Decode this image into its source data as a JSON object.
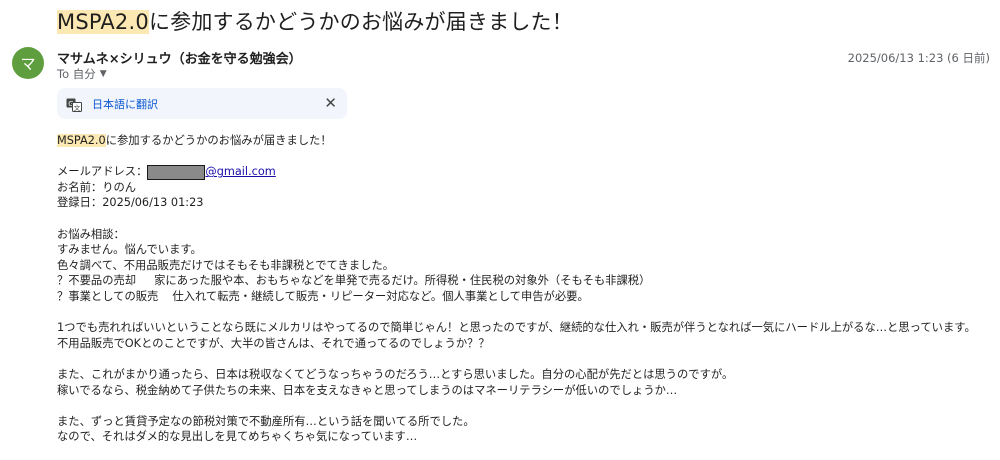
{
  "subject": {
    "highlight": "MSPA2.0",
    "rest": "に参加するかどうかのお悩みが届きました！"
  },
  "avatar": {
    "letter": "マ",
    "color": "#5f9e3e"
  },
  "sender": {
    "name": "マサムネ×シリュウ（お金を守る勉強会）"
  },
  "date": "2025/06/13 1:23 (6 日前)",
  "to_line": "To 自分",
  "translate_bar": {
    "label": "日本語に翻訳",
    "icon": "translate-icon",
    "close": "✕"
  },
  "body": {
    "intro_highlight": "MSPA2.0",
    "intro_rest": "に参加するかどうかのお悩みが届きました！",
    "email_label": "メールアドレス：",
    "email_domain": "@gmail.com",
    "name_line": "お名前：りのん",
    "registered_line": "登録日：2025/06/13 01:23",
    "consult_label": "お悩み相談：",
    "p1": [
      "すみません。悩んでいます。",
      "色々調べて、不用品販売だけではそもそも非課税とでてきました。"
    ],
    "item1_a": "？不要品の売却",
    "item1_b": "家にあった服や本、おもちゃなどを単発で売るだけ。所得税・住民税の対象外（そもそも非課税）",
    "item2_a": "？事業としての販売",
    "item2_b": "仕入れて転売・継続して販売・リピーター対応など。個人事業として申告が必要。",
    "p2": [
      "1つでも売れればいいということなら既にメルカリはやってるので簡単じゃん！と思ったのですが、継続的な仕入れ・販売が伴うとなれば一気にハードル上がるな…と思っています。",
      "不用品販売でOKとのことですが、大半の皆さんは、それで通ってるのでしょうか？？"
    ],
    "p3": [
      "また、これがまかり通ったら、日本は税収なくてどうなっちゃうのだろう…とすら思いました。自分の心配が先だとは思うのですが。",
      "稼いでるなら、税金納めて子供たちの未来、日本を支えなきゃと思ってしまうのはマネーリテラシーが低いのでしょうか…"
    ],
    "p4": [
      "また、ずっと賃貸予定なの節税対策で不動産所有…という話を聞いてる所でした。",
      "なので、それはダメ的な見出しを見てめちゃくちゃ気になっています…"
    ]
  },
  "colors": {
    "highlight": "#fce8b2",
    "link": "#1a0dab",
    "translate_bg": "#f2f6fc"
  }
}
